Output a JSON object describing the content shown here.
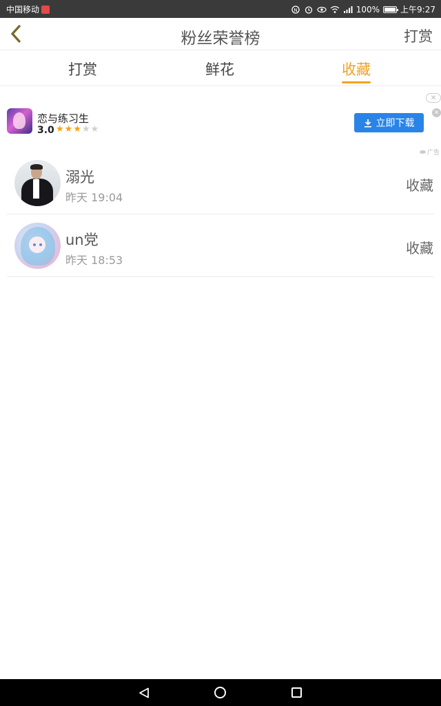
{
  "status_bar": {
    "carrier": "中国移动",
    "battery_level": 1.0,
    "battery_text": "100%",
    "time": "上午9:27",
    "icons": [
      "nfc-icon",
      "alarm-icon",
      "eye-icon",
      "wifi-icon",
      "signal-icon",
      "battery-icon"
    ]
  },
  "navbar": {
    "title": "粉丝荣誉榜",
    "right_action": "打赏",
    "back_icon": "chevron-left-icon"
  },
  "tabs": [
    {
      "label": "打赏",
      "active": false
    },
    {
      "label": "鲜花",
      "active": false
    },
    {
      "label": "收藏",
      "active": true
    }
  ],
  "ad": {
    "app_name": "恋与练习生",
    "rating": "3.0",
    "stars_filled": 3,
    "stars_total": 5,
    "download_label": "立即下载",
    "ad_tag": "广告",
    "close_symbol": "✕"
  },
  "list": {
    "items": [
      {
        "name": "溺光",
        "time": "昨天 19:04",
        "action": "收藏",
        "avatar": "avatar-man-in-suit"
      },
      {
        "name": "un党",
        "time": "昨天 18:53",
        "action": "收藏",
        "avatar": "avatar-anime-girl"
      }
    ]
  },
  "colors": {
    "accent": "#f0a222",
    "download_button": "#2a84e8",
    "status_bar": "#3a3a3a",
    "system_nav": "#000000"
  },
  "system_nav": {
    "buttons": [
      "back-triangle-icon",
      "home-circle-icon",
      "recent-square-icon"
    ]
  }
}
